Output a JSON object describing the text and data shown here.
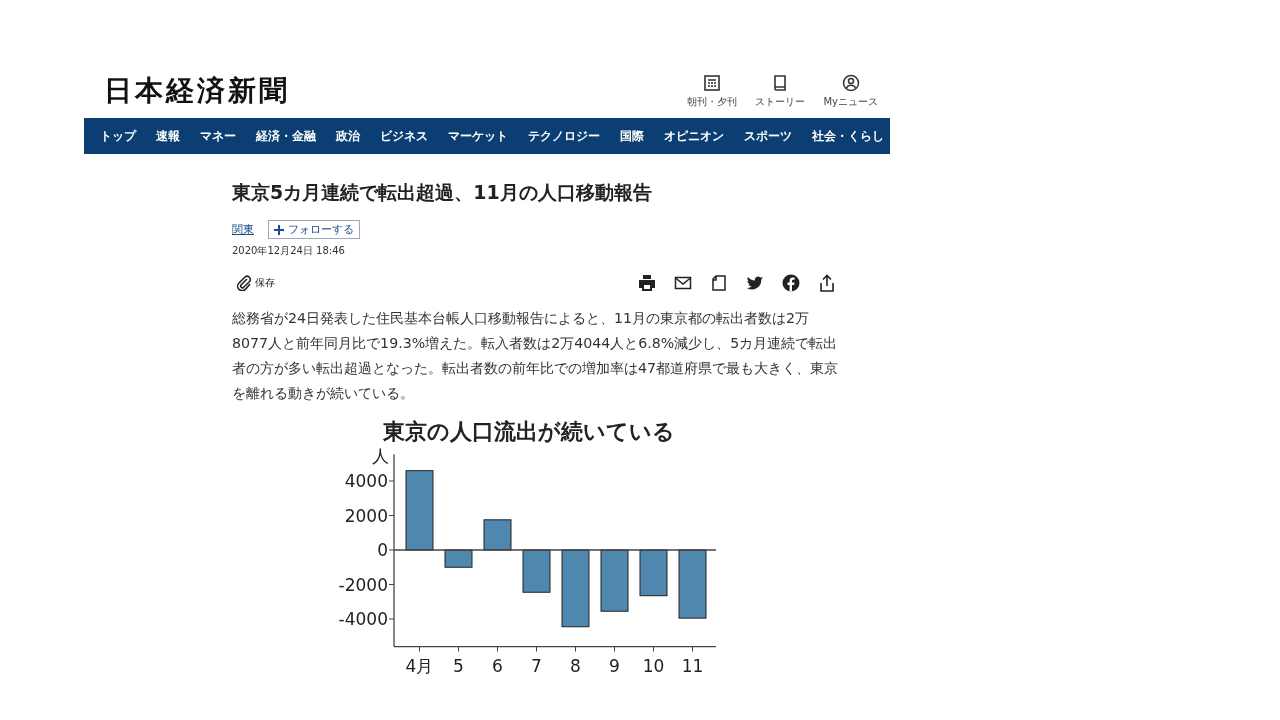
{
  "header": {
    "logo": "日本経済新聞",
    "links": [
      {
        "kind": "paper",
        "label": "朝刊・夕刊"
      },
      {
        "kind": "story",
        "label": "ストーリー"
      },
      {
        "kind": "user",
        "label": "Myニュース"
      }
    ]
  },
  "nav": [
    "トップ",
    "速報",
    "マネー",
    "経済・金融",
    "政治",
    "ビジネス",
    "マーケット",
    "テクノロジー",
    "国際",
    "オピニオン",
    "スポーツ",
    "社会・くらし"
  ],
  "article": {
    "title": "東京5カ月連続で転出超過、11月の人口移動報告",
    "topic": "関東",
    "follow": "フォローする",
    "date": "2020年12月24日 18:46",
    "save": "保存",
    "share": [
      {
        "kind": "print"
      },
      {
        "kind": "mail"
      },
      {
        "kind": "bookmark"
      },
      {
        "kind": "twitter"
      },
      {
        "kind": "facebook"
      },
      {
        "kind": "share"
      }
    ],
    "body": "総務省が24日発表した住民基本台帳人口移動報告によると、11月の東京都の転出者数は2万8077人と前年同月比で19.3%増えた。転入者数は2万4044人と6.8%減少し、5カ月連続で転出者の方が多い転出超過となった。転出者数の前年比での増加率は47都道府県で最も大きく、東京を離れる動きが続いている。",
    "chart_data": {
      "type": "bar",
      "title": "東京の人口流出が続いている",
      "ylabel": "人",
      "categories": [
        "4月",
        "5",
        "6",
        "7",
        "8",
        "9",
        "10",
        "11"
      ],
      "series": [
        {
          "color": "#4f87ae",
          "values": [
            4600,
            -1000,
            1750,
            -2450,
            -4450,
            -3550,
            -2650,
            -3950
          ]
        }
      ],
      "yticks": [
        4000,
        2000,
        0,
        -2000,
        -4000
      ],
      "ylim": [
        -5600,
        5550
      ]
    }
  }
}
